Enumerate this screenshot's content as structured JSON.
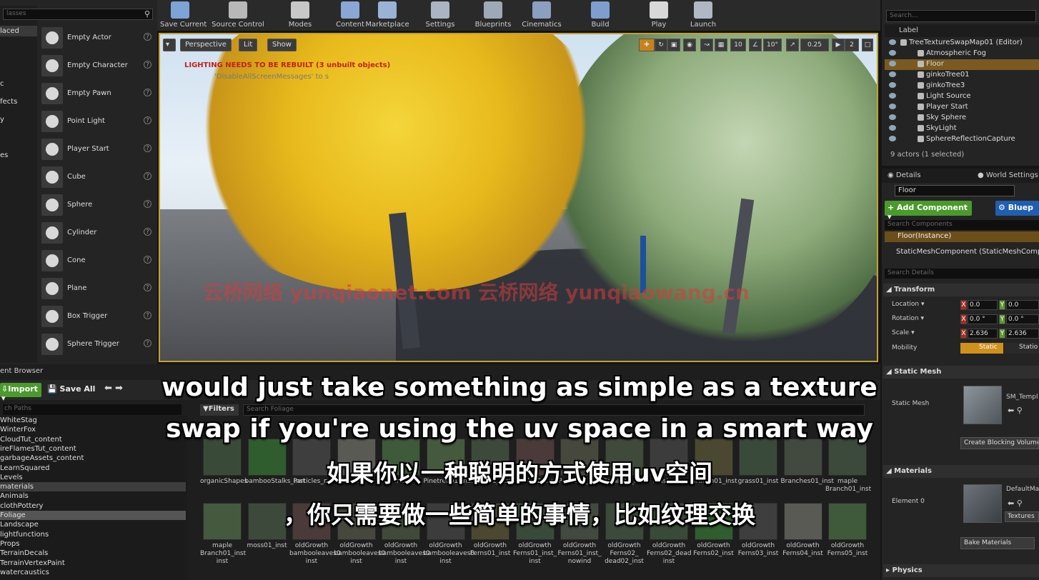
{
  "modes_panel": {
    "search_placeholder": "lasses",
    "categories": [
      {
        "label": "laced",
        "selected": true
      },
      {
        "label": "c"
      },
      {
        "label": "fects"
      },
      {
        "label": "y"
      },
      {
        "label": "es"
      }
    ],
    "items": [
      {
        "label": "Empty Actor",
        "icon": "sphere-icon"
      },
      {
        "label": "Empty Character",
        "icon": "character-icon"
      },
      {
        "label": "Empty Pawn",
        "icon": "pawn-icon"
      },
      {
        "label": "Point Light",
        "icon": "light-bulb-icon"
      },
      {
        "label": "Player Start",
        "icon": "flag-icon"
      },
      {
        "label": "Cube",
        "icon": "cube-icon"
      },
      {
        "label": "Sphere",
        "icon": "sphere-icon"
      },
      {
        "label": "Cylinder",
        "icon": "cylinder-icon"
      },
      {
        "label": "Cone",
        "icon": "cone-icon"
      },
      {
        "label": "Plane",
        "icon": "plane-icon"
      },
      {
        "label": "Box Trigger",
        "icon": "box-trigger-icon"
      },
      {
        "label": "Sphere Trigger",
        "icon": "sphere-trigger-icon"
      }
    ]
  },
  "toolbar": {
    "buttons": [
      {
        "label": "Save Current",
        "icon": "save-icon",
        "color": "#7ea3d6"
      },
      {
        "label": "Source Control",
        "icon": "source-control-icon",
        "color": "#b8b8b8"
      },
      {
        "label": "Modes",
        "icon": "modes-icon",
        "color": "#c8c8c8"
      },
      {
        "label": "Content",
        "icon": "content-icon",
        "color": "#8aa6d4"
      },
      {
        "label": "Marketplace",
        "icon": "marketplace-icon",
        "color": "#9ab2d6"
      },
      {
        "label": "Settings",
        "icon": "settings-icon",
        "color": "#aab4c2"
      },
      {
        "label": "Blueprints",
        "icon": "blueprints-icon",
        "color": "#9ea9b8"
      },
      {
        "label": "Cinematics",
        "icon": "cinematics-icon",
        "color": "#8c9fc0"
      },
      {
        "label": "Build",
        "icon": "build-icon",
        "color": "#7f9ed0"
      },
      {
        "label": "Play",
        "icon": "play-icon",
        "color": "#d8d8d8"
      },
      {
        "label": "Launch",
        "icon": "launch-icon",
        "color": "#b0b8c6"
      }
    ]
  },
  "viewport": {
    "perspective_label": "Perspective",
    "lit_label": "Lit",
    "show_label": "Show",
    "lighting_warning": "LIGHTING NEEDS TO BE REBUILT (3 unbuilt objects)",
    "disable_messages": "'DisableAllScreenMessages' to s",
    "grid_snap": "10",
    "rotation_snap": "10°",
    "scale_snap": "0.25",
    "camera_speed": "2",
    "watermark": "云桥网络 yunqiaonet.com 云桥网络 yunqiaowang.cn"
  },
  "outliner": {
    "search_placeholder": "Search...",
    "column_label": "Label",
    "rows": [
      {
        "label": "TreeTextureSwapMap01 (Editor)",
        "indent": 0
      },
      {
        "label": "Atmospheric Fog",
        "indent": 1
      },
      {
        "label": "Floor",
        "indent": 1,
        "selected": true
      },
      {
        "label": "ginkoTree01",
        "indent": 1
      },
      {
        "label": "ginkoTree3",
        "indent": 1
      },
      {
        "label": "Light Source",
        "indent": 1
      },
      {
        "label": "Player Start",
        "indent": 1
      },
      {
        "label": "Sky Sphere",
        "indent": 1
      },
      {
        "label": "SkyLight",
        "indent": 1
      },
      {
        "label": "SphereReflectionCapture",
        "indent": 1
      }
    ],
    "actor_count": "9 actors (1 selected)"
  },
  "details": {
    "tab_details": "Details",
    "tab_world": "World Settings",
    "name_value": "Floor",
    "add_component": "+ Add Component",
    "blueprint": "Bluep",
    "search_components": "Search Components",
    "floor_instance": "Floor(Instance)",
    "static_mesh_component": "StaticMeshComponent (StaticMeshComp",
    "search_details": "Search Details",
    "transform_header": "Transform",
    "location_label": "Location",
    "rotation_label": "Rotation",
    "scale_label": "Scale",
    "mobility_label": "Mobility",
    "location": {
      "x": "0.0",
      "y": "0.0"
    },
    "rotation": {
      "x": "0.0 °",
      "y": "0.0 °"
    },
    "scale": {
      "x": "2.636",
      "y": "2.636"
    },
    "mobility_static": "Static",
    "mobility_stationary": "Statio",
    "static_mesh_header": "Static Mesh",
    "static_mesh_label": "Static Mesh",
    "static_mesh_value": "SM_Templ",
    "create_blocking_volume": "Create Blocking Volume",
    "materials_header": "Materials",
    "element0_label": "Element 0",
    "material_value": "DefaultMat",
    "textures_dropdown": "Textures",
    "bake_materials": "Bake Materials",
    "physics_header": "Physics"
  },
  "content_browser": {
    "tab_label": "ent Browser",
    "import_label": "Import",
    "save_all": "Save All",
    "path_search_placeholder": "ch Paths",
    "filters_label": "Filters",
    "search_placeholder": "Search Foliage",
    "folders": [
      {
        "label": "WhiteStag"
      },
      {
        "label": "WinterFox"
      },
      {
        "label": "CloudTut_content"
      },
      {
        "label": "ireFlamesTut_content"
      },
      {
        "label": "garbageAssets_content"
      },
      {
        "label": "LearnSquared"
      },
      {
        "label": "Levels"
      },
      {
        "label": "materials",
        "highlight": true
      },
      {
        "label": "Animals"
      },
      {
        "label": "clothPottery"
      },
      {
        "label": "Foliage",
        "selected": true
      },
      {
        "label": "Landscape"
      },
      {
        "label": "lightfunctions"
      },
      {
        "label": "Props"
      },
      {
        "label": "TerrainDecals"
      },
      {
        "label": "TerrainVertexPaint"
      },
      {
        "label": "watercaustics"
      }
    ],
    "assets_row1": [
      "organicShapes",
      "bambooStalks_inst",
      "Particles_m",
      "master1",
      "inst",
      "Pinetree01_inst",
      "Petals01_inst",
      "Petals02_inst",
      "Petals03_inst",
      "Petals04_inst",
      "master_m",
      "Branch01_inst",
      "grass01_inst",
      "Branches01_inst",
      "maple Branch01_inst"
    ],
    "assets_row2": [
      "maple Branch01_inst inst",
      "moss01_inst",
      "oldGrowth bambooleaves0 inst",
      "oldGrowth bambooleaves0 inst",
      "oldGrowth bambooleaves0 inst",
      "oldGrowth bambooleaves0 inst",
      "oldGrowth Ferns01_inst",
      "oldGrowth Ferns01_inst_ inst",
      "oldGrowth Ferns01_inst_ nowind",
      "oldGrowth Ferns02_ dead02_inst",
      "oldGrowth Ferns02_dead inst",
      "oldGrowth Ferns02_inst",
      "oldGrowth Ferns03_inst",
      "oldGrowth Ferns04_inst",
      "oldGrowth Ferns05_inst"
    ]
  },
  "subtitles": {
    "line1": "would just take something as simple as a texture",
    "line2": "swap if you're using the uv space in a smart way",
    "line3": "如果你以一种聪明的方式使用uv空间",
    "line4": "，你只需要做一些简单的事情，比如纹理交换"
  }
}
